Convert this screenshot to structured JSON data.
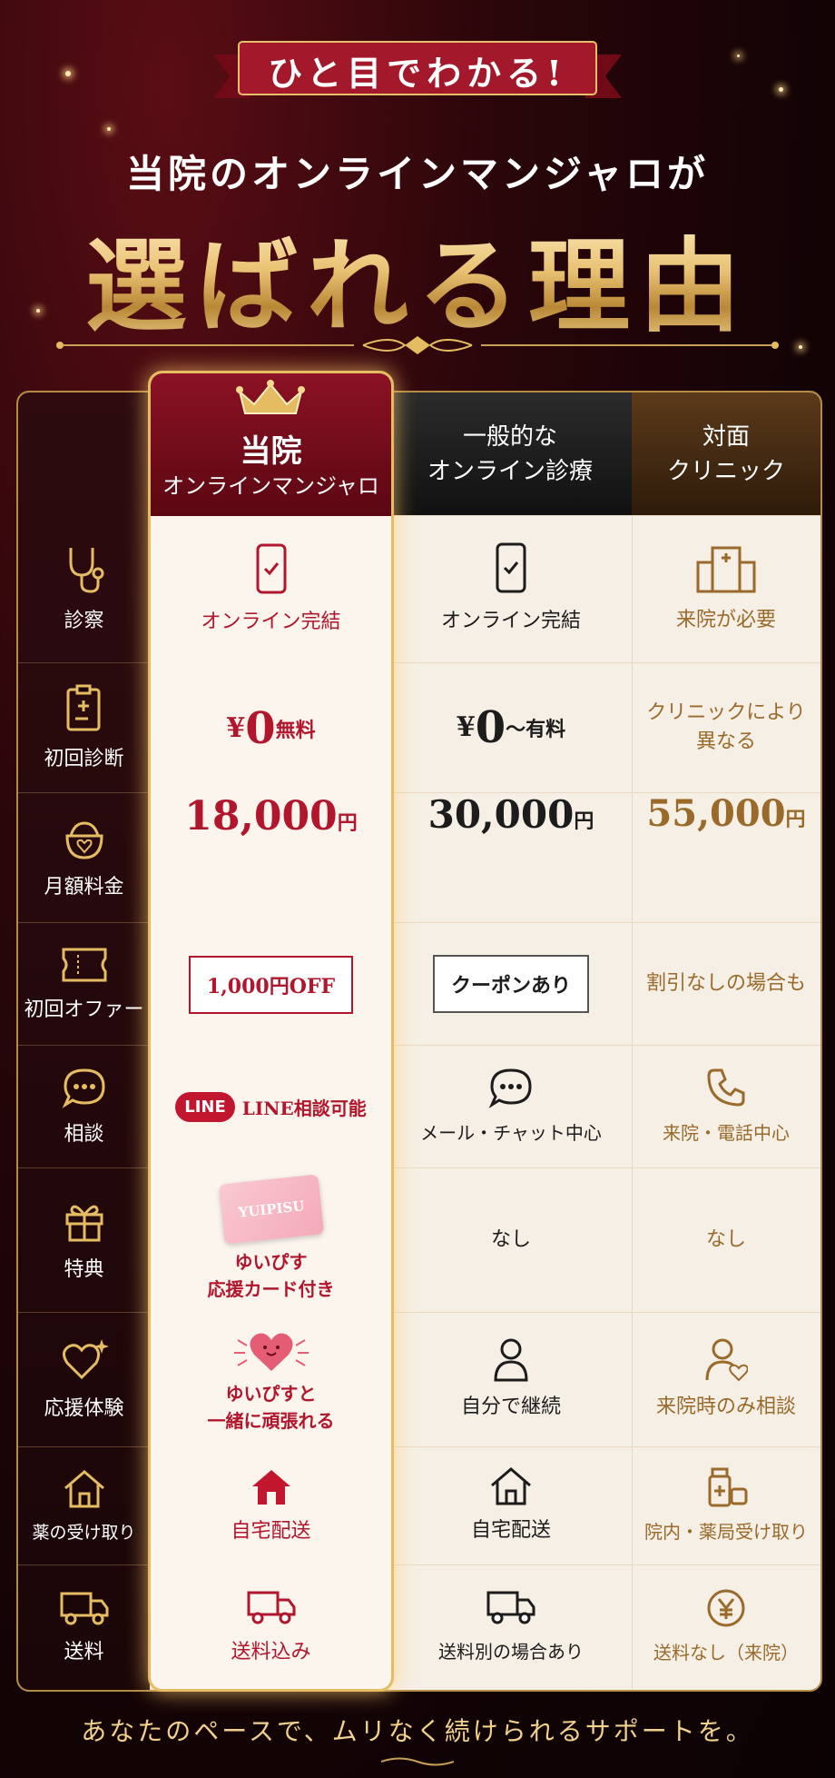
{
  "ribbon": "ひと目でわかる!",
  "subtitle": "当院のオンラインマンジャロが",
  "title": "選ばれる理由",
  "columns": {
    "ours_line1": "当院",
    "ours_line2": "オンラインマンジャロ",
    "ippan_line1": "一般的な",
    "ippan_line2": "オンライン診療",
    "taimen_line1": "対面",
    "taimen_line2": "クリニック"
  },
  "rows": [
    {
      "label": "診察",
      "icon": "stethoscope-icon",
      "ours": "オンライン完結",
      "ippan": "オンライン完結",
      "taimen": "来院が必要"
    },
    {
      "label": "初回診断",
      "icon": "clipboard-icon",
      "ours_yen": "¥",
      "ours_num": "0",
      "ours_suffix": "無料",
      "ippan_yen": "¥",
      "ippan_num": "0",
      "ippan_suffix": "〜有料",
      "taimen_l1": "クリニックにより",
      "taimen_l2": "異なる"
    },
    {
      "label": "月額料金",
      "icon": "purse-icon",
      "ours_num": "18,000",
      "ippan_num": "30,000",
      "taimen_num": "55,000",
      "unit": "円"
    },
    {
      "label": "初回オファー",
      "icon": "ticket-icon",
      "ours": "1,000円OFF",
      "ippan": "クーポンあり",
      "taimen": "割引なしの場合も"
    },
    {
      "label": "相談",
      "icon": "chat-icon",
      "ours_logo": "LINE",
      "ours": "LINE相談可能",
      "ippan": "メール・チャット中心",
      "taimen": "来院・電話中心"
    },
    {
      "label": "特典",
      "icon": "gift-icon",
      "ours_card": "YUIPISU",
      "ours_l1": "ゆいぴす",
      "ours_l2": "応援カード付き",
      "ippan": "なし",
      "taimen": "なし"
    },
    {
      "label": "応援体験",
      "icon": "heart-icon",
      "ours_l1": "ゆいぴすと",
      "ours_l2": "一緒に頑張れる",
      "ippan": "自分で継続",
      "taimen": "来院時のみ相談"
    },
    {
      "label": "薬の受け取り",
      "icon": "home-icon",
      "ours": "自宅配送",
      "ippan": "自宅配送",
      "taimen": "院内・薬局受け取り"
    },
    {
      "label": "送料",
      "icon": "truck-icon",
      "ours": "送料込み",
      "ippan": "送料別の場合あり",
      "taimen": "送料なし（来院）"
    }
  ],
  "footer": "あなたのペースで、ムリなく続けられるサポートを。",
  "colors": {
    "accent": "#b2162d",
    "gold": "#e5bc62",
    "brown": "#9a6a2a"
  }
}
